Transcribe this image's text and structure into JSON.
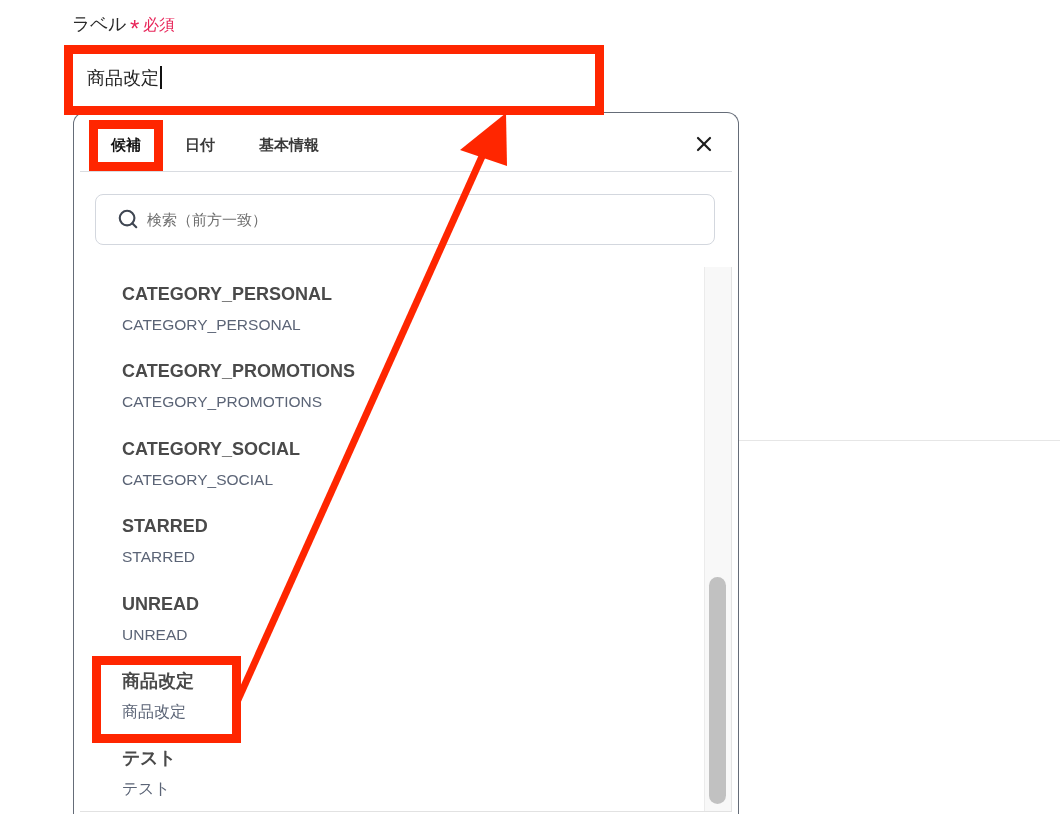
{
  "field": {
    "label": "ラベル",
    "required_mark": "*",
    "required_text": "必須",
    "value": "商品改定",
    "highlighted": true
  },
  "dropdown": {
    "tabs": [
      {
        "label": "候補",
        "selected": true,
        "highlighted": true
      },
      {
        "label": "日付",
        "selected": false,
        "highlighted": false
      },
      {
        "label": "基本情報",
        "selected": false,
        "highlighted": false
      }
    ],
    "search": {
      "placeholder": "検索（前方一致）"
    },
    "options": [
      {
        "title": "CATEGORY_PERSONAL",
        "value": "CATEGORY_PERSONAL",
        "highlighted": false
      },
      {
        "title": "CATEGORY_PROMOTIONS",
        "value": "CATEGORY_PROMOTIONS",
        "highlighted": false
      },
      {
        "title": "CATEGORY_SOCIAL",
        "value": "CATEGORY_SOCIAL",
        "highlighted": false
      },
      {
        "title": "STARRED",
        "value": "STARRED",
        "highlighted": false
      },
      {
        "title": "UNREAD",
        "value": "UNREAD",
        "highlighted": false
      },
      {
        "title": "商品改定",
        "value": "商品改定",
        "highlighted": true
      },
      {
        "title": "テスト",
        "value": "テスト",
        "highlighted": false
      }
    ]
  },
  "annotation_arrow": true
}
